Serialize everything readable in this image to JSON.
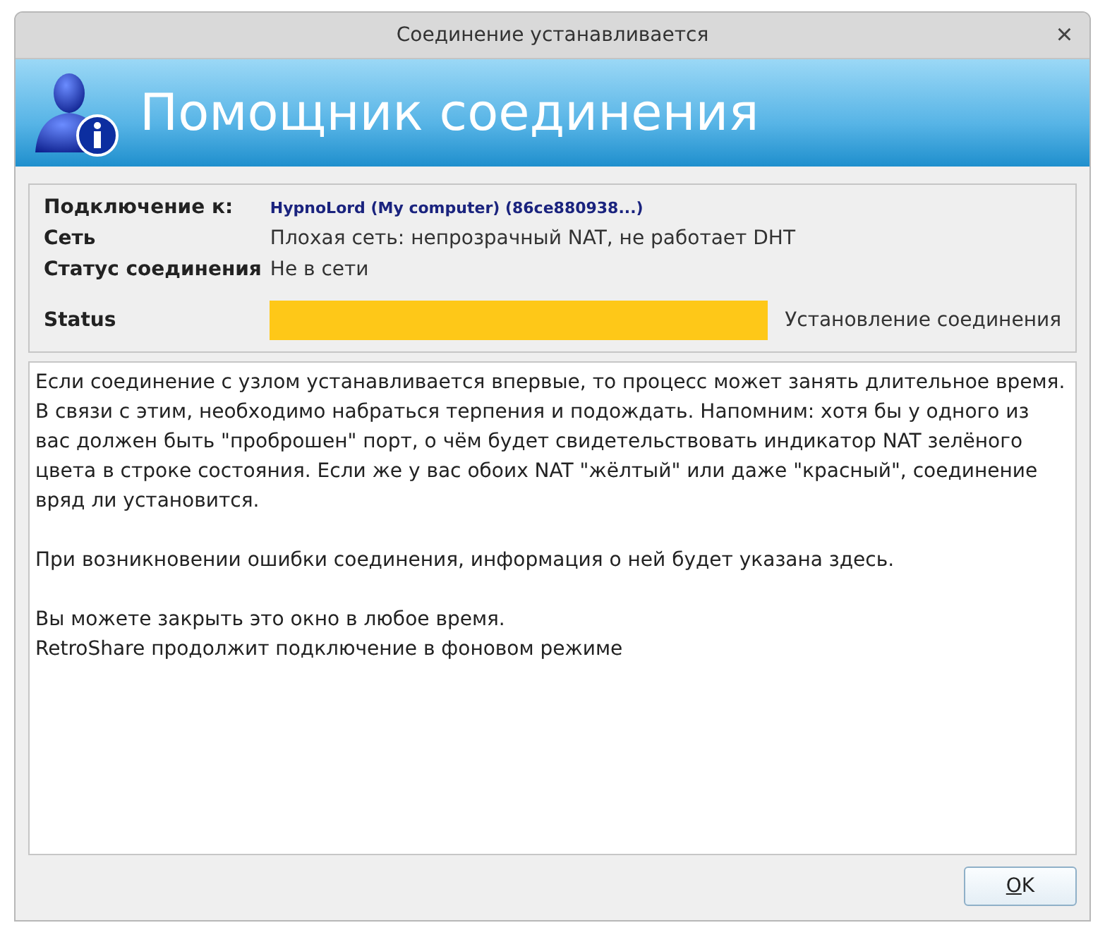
{
  "window": {
    "title": "Соединение устанавливается",
    "close": "×"
  },
  "banner": {
    "title": "Помощник соединения"
  },
  "info": [
    {
      "label": "Подключение к:",
      "value": "HypnoLord (My computer) (86ce880938...)",
      "kind": "link"
    },
    {
      "label": "Сеть",
      "value": "Плохая сеть: непрозрачный NAT, не работает DHT",
      "kind": "text"
    },
    {
      "label": "Статус соединения",
      "value": "Не в сети",
      "kind": "text"
    }
  ],
  "status": {
    "label": "Status",
    "text": "Установление соединения"
  },
  "message": [
    "Если соединение с узлом устанавливается впервые, то процесс может занять длительное время. В связи с этим, необходимо набраться терпения и подождать. Напомним: хотя бы у одного из вас должен быть \"проброшен\" порт, о чём будет свидетельствовать индикатор NAT зелёного цвета в строке состояния. Если же у вас обоих NAT \"жёлтый\" или даже \"красный\", соединение вряд ли установится.",
    "При возникновении ошибки соединения, информация о ней будет указана здесь.",
    "Вы можете закрыть это окно в любое время.\nRetroShare продолжит подключение в фоновом режиме"
  ],
  "buttons": [
    "OK"
  ]
}
